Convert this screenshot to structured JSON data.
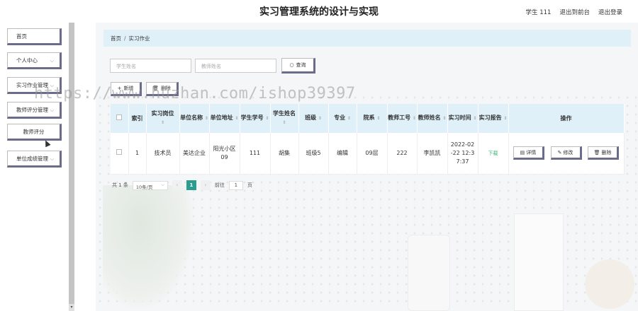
{
  "header": {
    "title": "实习管理系统的设计与实现",
    "user": "学生 111",
    "back_to_frontend": "退出到前台",
    "logout": "退出登录"
  },
  "sidebar": {
    "items": [
      {
        "label": "首页",
        "has_chevron": false
      },
      {
        "label": "个人中心",
        "has_chevron": true
      },
      {
        "label": "实习作业管理",
        "has_chevron": true
      },
      {
        "label": "教师评分管理",
        "has_chevron": true
      },
      {
        "label": "教师评分",
        "has_chevron": false
      },
      {
        "label": "单位成绩管理",
        "has_chevron": true
      }
    ]
  },
  "breadcrumb": {
    "home": "首页",
    "separator": "/",
    "current": "实习作业"
  },
  "search": {
    "student_name_placeholder": "学生姓名",
    "teacher_name_placeholder": "教师姓名",
    "button_label": "查询"
  },
  "actions": {
    "add_label": "新增",
    "delete_label": "删除"
  },
  "watermark": "https://www.huzhan.com/ishop39397",
  "table": {
    "headers": [
      "索引",
      "实习岗位",
      "单位名称",
      "单位地址",
      "学生学号",
      "学生姓名",
      "班级",
      "专业",
      "院系",
      "教师工号",
      "教师姓名",
      "实习时间",
      "实习报告",
      "操作"
    ],
    "rows": [
      {
        "index": "1",
        "position": "技术员",
        "company": "美达企业",
        "address": "阳光小区09",
        "student_no": "111",
        "student_name": "胡集",
        "class": "班级5",
        "major": "编辑",
        "department": "09层",
        "teacher_no": "222",
        "teacher_name": "李凯凯",
        "time": "2022-02-22 12:37:37",
        "report": "下载",
        "detail_label": "详情",
        "edit_label": "修改",
        "delete_label": "删除"
      }
    ]
  },
  "pager": {
    "total": "共 1 条",
    "page_size": "10条/页",
    "current_page": "1",
    "goto_label": "前往",
    "goto_value": "1",
    "page_suffix": "页"
  },
  "colors": {
    "header_bg": "#dff0f8",
    "accent": "#2a9d8f",
    "button_shadow": "#6b6b8a",
    "link_green": "#3cb371"
  }
}
